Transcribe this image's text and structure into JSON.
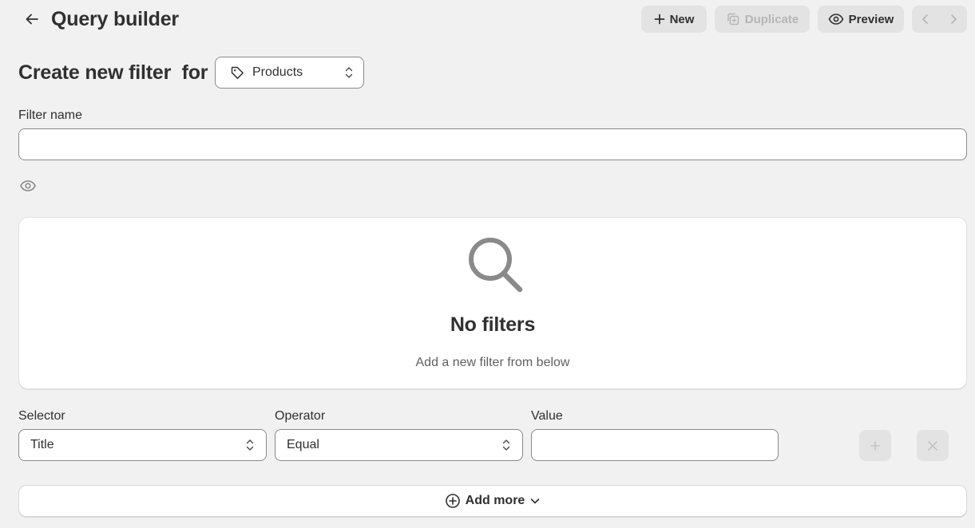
{
  "header": {
    "title": "Query builder",
    "back_icon": "arrow-left-icon",
    "buttons": {
      "new": {
        "label": "New",
        "icon": "plus-icon"
      },
      "duplicate": {
        "label": "Duplicate",
        "icon": "duplicate-icon",
        "disabled": true
      },
      "preview": {
        "label": "Preview",
        "icon": "eye-icon"
      }
    },
    "pager": {
      "prev_icon": "chevron-left-icon",
      "next_icon": "chevron-right-icon"
    }
  },
  "create": {
    "label": "Create new filter  for",
    "resource": {
      "value": "Products",
      "icon": "tag-icon"
    }
  },
  "filter_name": {
    "label": "Filter name",
    "value": "",
    "visibility_icon": "eye-icon"
  },
  "empty_state": {
    "icon": "search-icon",
    "title": "No filters",
    "subtitle": "Add a new filter from below"
  },
  "filter_row": {
    "selector": {
      "label": "Selector",
      "value": "Title"
    },
    "operator": {
      "label": "Operator",
      "value": "Equal"
    },
    "value": {
      "label": "Value",
      "value": ""
    },
    "add_icon": "plus-icon",
    "remove_icon": "close-icon"
  },
  "add_more": {
    "label": "Add more",
    "icon": "plus-circle-icon",
    "chevron": "chevron-down-icon"
  },
  "colors": {
    "background": "#f1f1f1",
    "text": "#303030",
    "muted_text": "#616161",
    "disabled_text": "#b5b5b5",
    "button_bg": "#e3e3e3",
    "border": "#8a8a8a",
    "surface": "#ffffff"
  }
}
